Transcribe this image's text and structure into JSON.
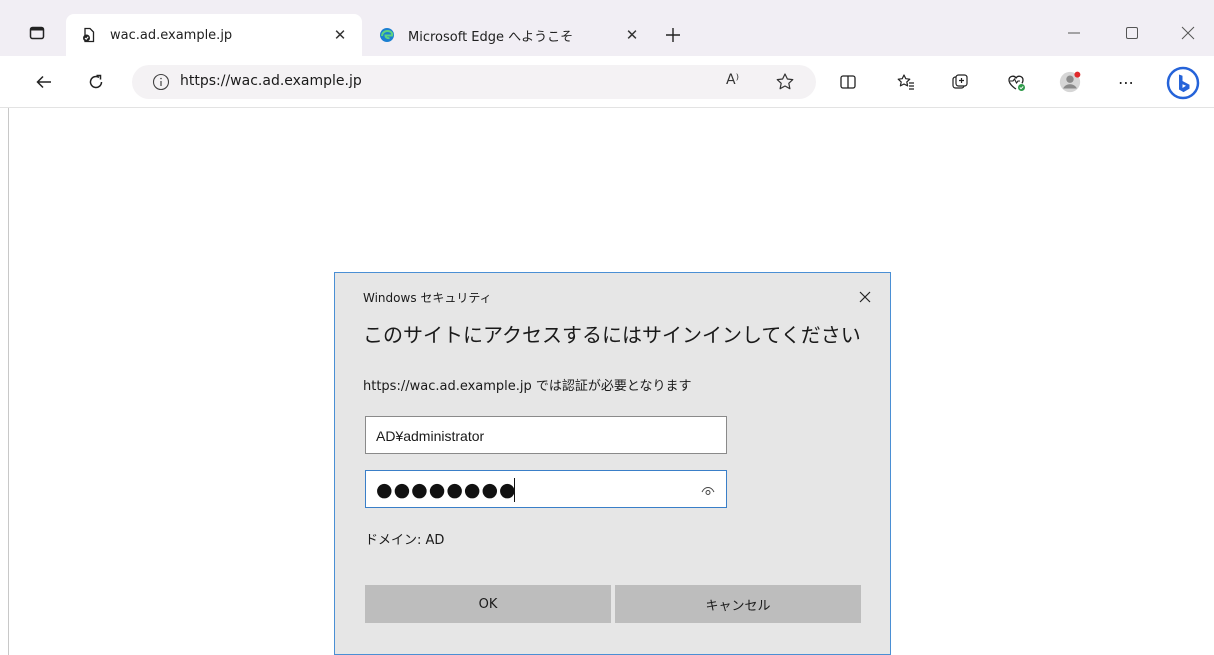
{
  "browser": {
    "tabs": [
      {
        "title": "wac.ad.example.jp",
        "active": true
      },
      {
        "title": "Microsoft Edge へようこそ",
        "active": false
      }
    ],
    "address": {
      "url": "https://wac.ad.example.jp"
    },
    "toolbar_icons": [
      "back-icon",
      "refresh-icon",
      "info-icon",
      "read-aloud-icon",
      "favorite-star-icon",
      "split-screen-icon",
      "favorites-icon",
      "collections-icon",
      "browser-essentials-icon",
      "profile-icon",
      "more-icon",
      "bing-icon"
    ],
    "read_aloud_label": "A⁾",
    "more_label": "⋯",
    "colors": {
      "accent": "#3a7fc8",
      "tabstrip": "#f1eef4",
      "dialog_bg": "#e6e6e6",
      "button_bg": "#bdbdbd"
    }
  },
  "dialog": {
    "caption": "Windows セキュリティ",
    "heading": "このサイトにアクセスするにはサインインしてください",
    "message": "https://wac.ad.example.jp では認証が必要となります",
    "username_value": "AD¥administrator",
    "password_masked": "●●●●●●●●",
    "domain_text": "ドメイン: AD",
    "ok_label": "OK",
    "cancel_label": "キャンセル"
  }
}
